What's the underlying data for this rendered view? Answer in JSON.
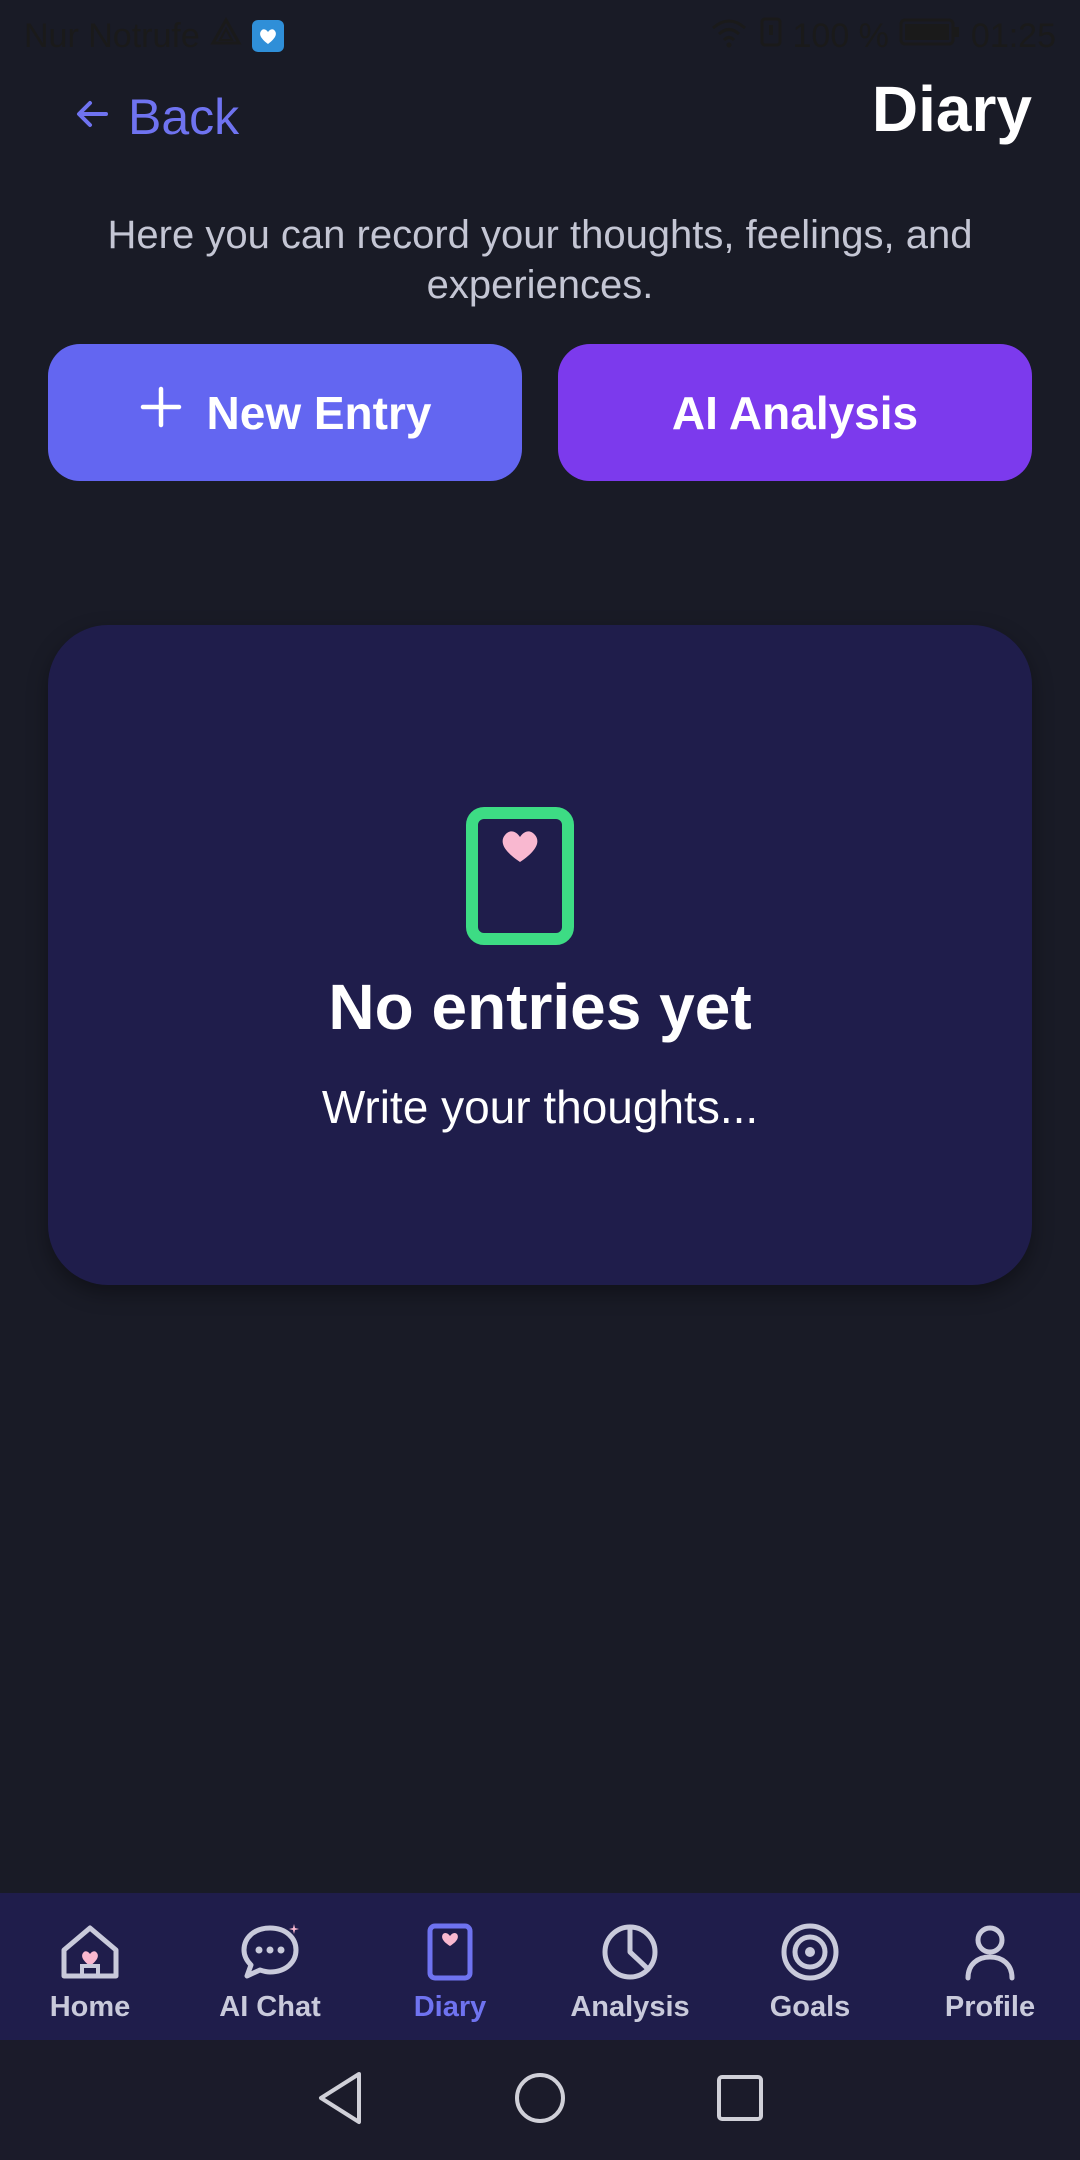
{
  "status_bar": {
    "carrier": "Nur Notrufe",
    "battery": "100 %",
    "time": "01:25"
  },
  "header": {
    "back_label": "Back",
    "title": "Diary"
  },
  "intro_text": "Here you can record your thoughts, feelings, and experiences.",
  "actions": {
    "new_entry_label": "New Entry",
    "ai_analysis_label": "AI Analysis"
  },
  "empty_state": {
    "title": "No entries yet",
    "subtitle": "Write your thoughts..."
  },
  "bottom_nav": {
    "items": [
      {
        "label": "Home",
        "icon": "home-icon"
      },
      {
        "label": "AI Chat",
        "icon": "chat-icon"
      },
      {
        "label": "Diary",
        "icon": "diary-icon",
        "active": true
      },
      {
        "label": "Analysis",
        "icon": "pie-chart-icon"
      },
      {
        "label": "Goals",
        "icon": "target-icon"
      },
      {
        "label": "Profile",
        "icon": "user-icon"
      }
    ]
  },
  "colors": {
    "background": "#191b26",
    "accent": "#6366f1",
    "purple": "#7c3aed",
    "card": "#1f1d4b",
    "green": "#3ddc84",
    "heart": "#f9b8d0"
  }
}
